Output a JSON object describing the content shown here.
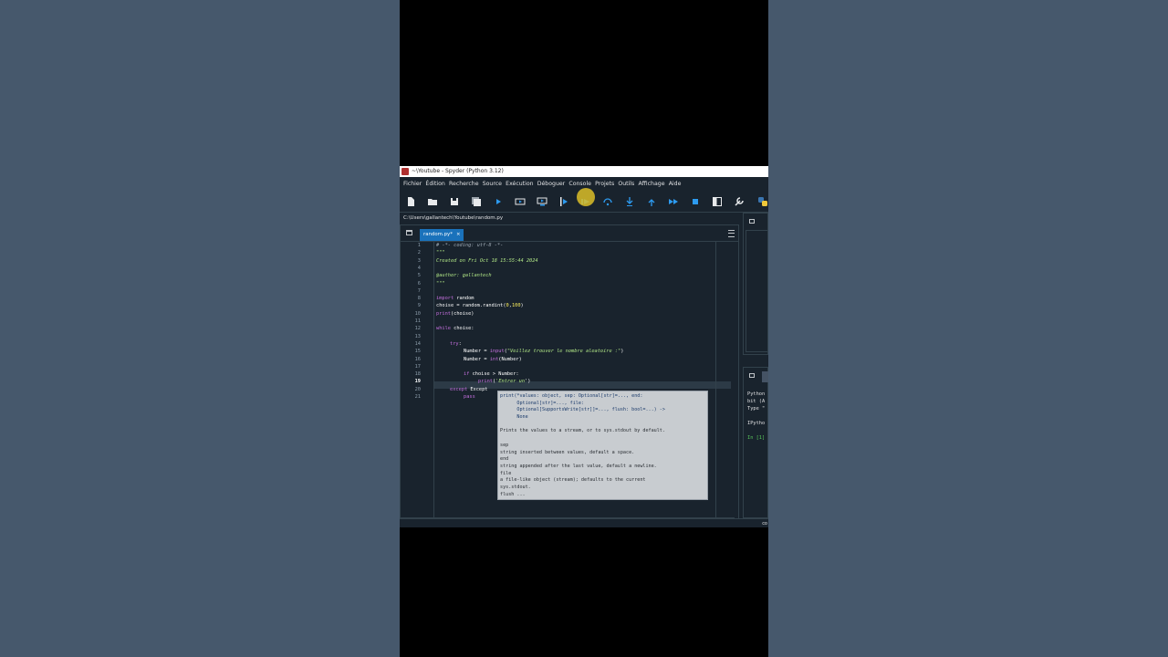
{
  "window": {
    "title": "~\\Youtube - Spyder (Python 3.12)"
  },
  "menu": [
    "Fichier",
    "Édition",
    "Recherche",
    "Source",
    "Exécution",
    "Déboguer",
    "Console",
    "Projets",
    "Outils",
    "Affichage",
    "Aide"
  ],
  "toolbar": {
    "icons": [
      "new-file-icon",
      "open-folder-icon",
      "save-icon",
      "save-all-icon",
      "run-icon",
      "run-cell-icon",
      "run-cell-advance-icon",
      "run-selection-icon",
      "debug-icon",
      "step-over-icon",
      "step-into-icon",
      "step-return-icon",
      "continue-icon",
      "stop-icon",
      "maximize-pane-icon",
      "preferences-icon",
      "python-path-icon"
    ],
    "colors": {
      "accent": "#1a72bb",
      "run": "#2d9bf0",
      "stop": "#2d9bf0"
    }
  },
  "path": "C:\\Users\\gallantech\\Youtube\\random.py",
  "editor": {
    "tab_label": "random.py*",
    "tab_close": "×",
    "current_line": 19,
    "line_numbers": [
      "1",
      "2",
      "3",
      "4",
      "5",
      "6",
      "7",
      "8",
      "9",
      "10",
      "11",
      "12",
      "13",
      "14",
      "15",
      "16",
      "17",
      "18",
      "19",
      "20",
      "21"
    ],
    "code": {
      "l1": "# -*- coding: utf-8 -*-",
      "l2": "\"\"\"",
      "l3": "Created on Fri Oct 18 15:55:44 2024",
      "l5": "@author: gallantech",
      "l6": "\"\"\"",
      "l8_kw": "import",
      "l8_rest": " random",
      "l9_a": "choise = random.randint(",
      "l9_n1": "0",
      "l9_c": ",",
      "l9_n2": "100",
      "l9_e": ")",
      "l10_kw": "print",
      "l10_rest": "(choise)",
      "l12_kw": "while",
      "l12_rest": " choise:",
      "l14_kw": "try",
      "l14_rest": ":",
      "l15_a": "Number = ",
      "l15_kw": "input",
      "l15_b": "(",
      "l15_str": "\"Veillez trouver le nombre aleatoire :\"",
      "l15_e": ")",
      "l16_a": "Number = ",
      "l16_kw": "int",
      "l16_b": "(Number)",
      "l18_kw": "if",
      "l18_rest": " choise > Number:",
      "l19_kw": "print",
      "l19_b": "(",
      "l19_str": "'Entrer un",
      "l19_e": "')",
      "l20_kw": "except",
      "l20_rest": " Except",
      "l21_kw": "pass"
    }
  },
  "tooltip": {
    "lines": [
      "print(*values: object, sep: Optional[str]=..., end:",
      "      Optional[str]=..., file:",
      "      Optional[SupportsWrite[str]]=..., flush: bool=...) ->",
      "      None",
      "",
      "Prints the values to a stream, or to sys.stdout by default.",
      "",
      "sep",
      "string inserted between values, default a space.",
      "end",
      "string appended after the last value, default a newline.",
      "file",
      "a file-like object (stream); defaults to the current",
      "sys.stdout.",
      "flush ..."
    ]
  },
  "console": {
    "lines": [
      "Python",
      "bit (A",
      "Type \"",
      "IPytho",
      "In [1]"
    ]
  },
  "statusbar": {
    "right": "co"
  }
}
